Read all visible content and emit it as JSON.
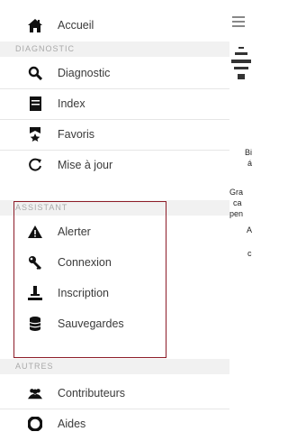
{
  "drawer": {
    "home": {
      "label": "Accueil",
      "icon": "home-icon"
    },
    "sections": {
      "section1": "DIAGNOSTIC",
      "section2": "ASSISTANT",
      "section3": "AUTRES"
    },
    "items1": [
      {
        "label": "Diagnostic",
        "icon": "search-icon"
      },
      {
        "label": "Index",
        "icon": "book-icon"
      },
      {
        "label": "Favoris",
        "icon": "bookmark-star-icon"
      },
      {
        "label": "Mise à jour",
        "icon": "refresh-icon"
      }
    ],
    "items2": [
      {
        "label": "Alerter",
        "icon": "warning-icon"
      },
      {
        "label": "Connexion",
        "icon": "key-icon"
      },
      {
        "label": "Inscription",
        "icon": "user-add-icon"
      },
      {
        "label": "Sauvegardes",
        "icon": "database-icon"
      }
    ],
    "items3": [
      {
        "label": "Contributeurs",
        "icon": "group-icon"
      },
      {
        "label": "Aides",
        "icon": "help-lifebuoy-icon"
      }
    ]
  },
  "colors": {
    "highlight_border": "#8d1c28",
    "section_bg": "#f1f1f1",
    "icon": "#111111"
  },
  "peek_text": {
    "line1": "Bi",
    "line2": "á",
    "line3": "Gra",
    "line4": "ca",
    "line5": "pen",
    "line6": "A",
    "line7": "c"
  }
}
